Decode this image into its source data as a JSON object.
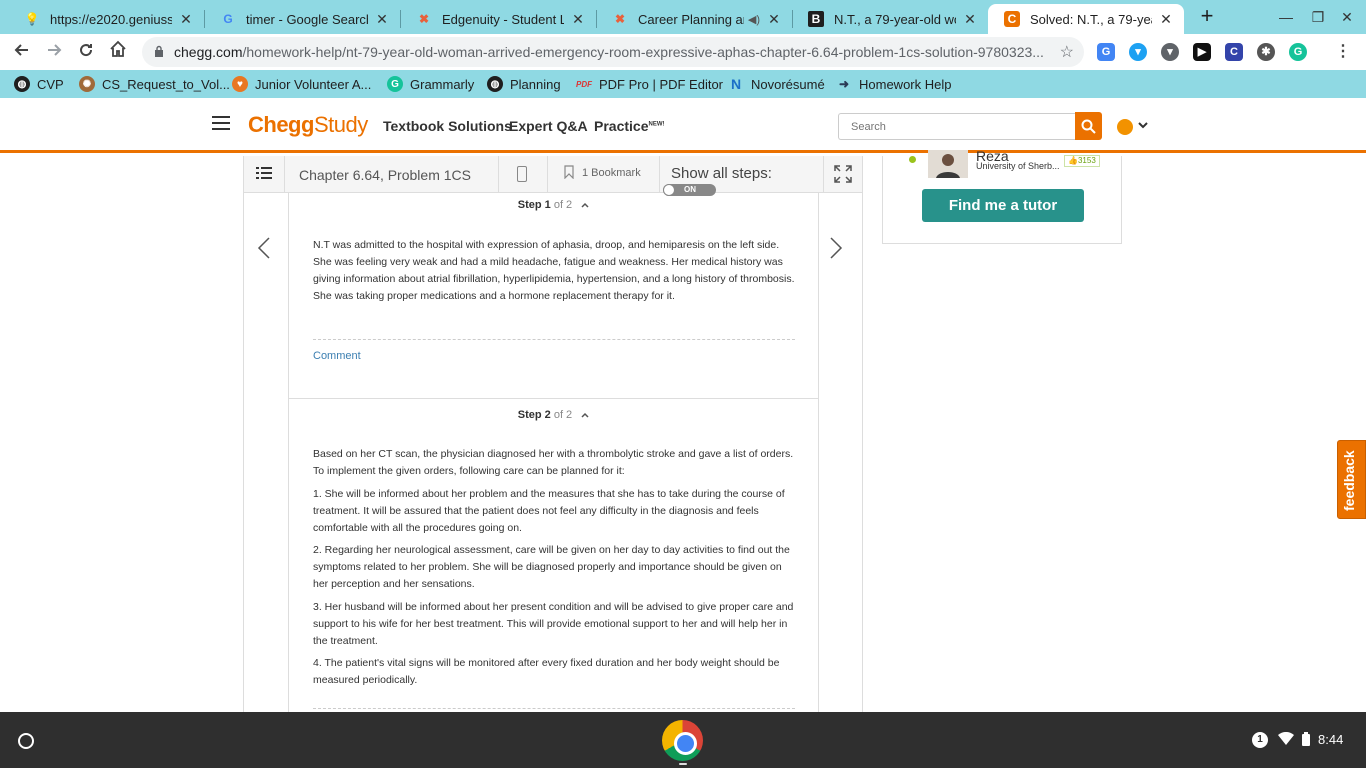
{
  "browser": {
    "tabs": [
      {
        "title": "https://e2020.geniussis",
        "icon": "lightbulb-icon"
      },
      {
        "title": "timer - Google Search",
        "icon": "google-icon"
      },
      {
        "title": "Edgenuity - Student Lear",
        "icon": "edgenuity-icon"
      },
      {
        "title": "Career Planning and",
        "icon": "edgenuity-icon"
      },
      {
        "title": "N.T., a 79-year-old woma",
        "icon": "b-icon"
      },
      {
        "title": "Solved: N.T., a 79-year-ol",
        "icon": "chegg-icon",
        "active": true
      }
    ],
    "url_host": "chegg.com",
    "url_path": "/homework-help/nt-79-year-old-woman-arrived-emergency-room-expressive-aphas-chapter-6.64-problem-1cs-solution-9780323...",
    "bookmarks": [
      {
        "label": "CVP",
        "icon": "globe-icon"
      },
      {
        "label": "CS_Request_to_Vol...",
        "icon": "gear-icon"
      },
      {
        "label": "Junior Volunteer A...",
        "icon": "heart-icon"
      },
      {
        "label": "Grammarly",
        "icon": "grammarly-icon"
      },
      {
        "label": "Planning",
        "icon": "globe-icon"
      },
      {
        "label": "PDF Pro | PDF Editor",
        "icon": "pdf-icon"
      },
      {
        "label": "Novorésumé",
        "icon": "novoresume-icon"
      },
      {
        "label": "Homework Help",
        "icon": "homework-icon"
      }
    ]
  },
  "chegg": {
    "logo_brand": "Chegg",
    "logo_study": "Study",
    "nav": {
      "textbook": "Textbook Solutions",
      "expert": "Expert Q&A",
      "practice": "Practice",
      "practice_badge": "NEW!"
    },
    "search": {
      "placeholder": "Search"
    },
    "brand_color": "#eb7100"
  },
  "solution": {
    "chapter": "Chapter 6.64, Problem 1CS",
    "bookmark_label": "1 Bookmark",
    "show_all": "Show all steps:",
    "toggle_label": "ON",
    "steps": [
      {
        "label": "Step 1",
        "of": "of 2",
        "paragraphs": [
          "N.T was admitted to the hospital with expression of aphasia, droop, and hemiparesis on the left side. She was feeling very weak and had a mild headache, fatigue and weakness. Her medical history was giving information about atrial fibrillation, hyperlipidemia, hypertension, and a long history of thrombosis. She was taking proper medications and a hormone replacement therapy for it."
        ],
        "comment": "Comment"
      },
      {
        "label": "Step 2",
        "of": "of 2",
        "paragraphs": [
          "Based on her CT scan, the physician diagnosed her with a thrombolytic stroke and gave a list of orders. To implement the given orders, following care can be planned for it:",
          "1. She will be informed about her problem and the measures that she has to take during the course of treatment. It will be assured that the patient does not feel any difficulty in the diagnosis and feels comfortable with all the procedures going on.",
          "2. Regarding her neurological assessment, care will be given on her day to day activities to find out the symptoms related to her problem. She will be diagnosed properly and importance should be given on her perception and her sensations.",
          "3. Her husband will be informed about her present condition and will be advised to give proper care and support to his wife for her best treatment. This will provide emotional support to her and will help her in the treatment.",
          "4. The patient's vital signs will be monitored after every fixed duration and her body weight should be measured periodically."
        ]
      }
    ]
  },
  "tutor": {
    "name": "Reza",
    "school": "University of Sherb...",
    "score": "3153",
    "cta": "Find me a tutor"
  },
  "feedback": "feedback",
  "shelf": {
    "notification_count": "1",
    "time": "8:44"
  }
}
